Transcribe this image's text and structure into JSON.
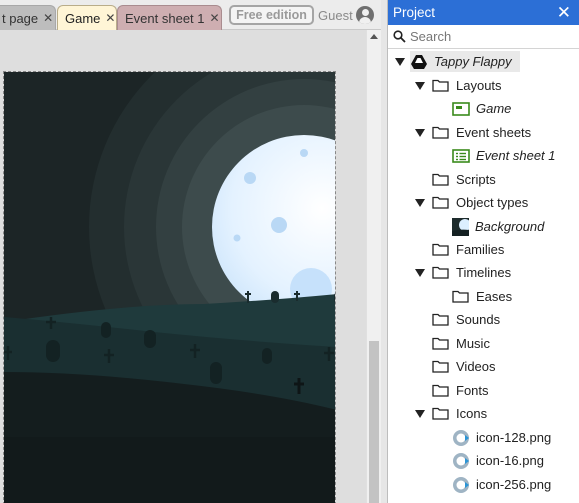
{
  "tabs": [
    {
      "label": "t page",
      "close": "✕"
    },
    {
      "label": "Game",
      "close": "✕"
    },
    {
      "label": "Event sheet 1",
      "close": "✕"
    }
  ],
  "edition_badge": "Free edition",
  "user": {
    "name": "Guest",
    "icon": "user-icon"
  },
  "project_panel": {
    "title": "Project",
    "close": "✕",
    "search_placeholder": "Search",
    "tree": {
      "root": "Tappy Flappy",
      "layouts": "Layouts",
      "game_layout": "Game",
      "event_sheets": "Event sheets",
      "event_sheet_1": "Event sheet 1",
      "scripts": "Scripts",
      "object_types": "Object types",
      "background": "Background",
      "families": "Families",
      "timelines": "Timelines",
      "eases": "Eases",
      "sounds": "Sounds",
      "music": "Music",
      "videos": "Videos",
      "fonts": "Fonts",
      "icons": "Icons",
      "icon_files": [
        "icon-128.png",
        "icon-16.png",
        "icon-256.png"
      ]
    }
  },
  "colors": {
    "accent": "#2c6fd6",
    "tab_active": "#fff5d6",
    "tab_event_sheet": "#ceaeb1",
    "moon": "#dff0ff",
    "sky": "#1d2728"
  }
}
